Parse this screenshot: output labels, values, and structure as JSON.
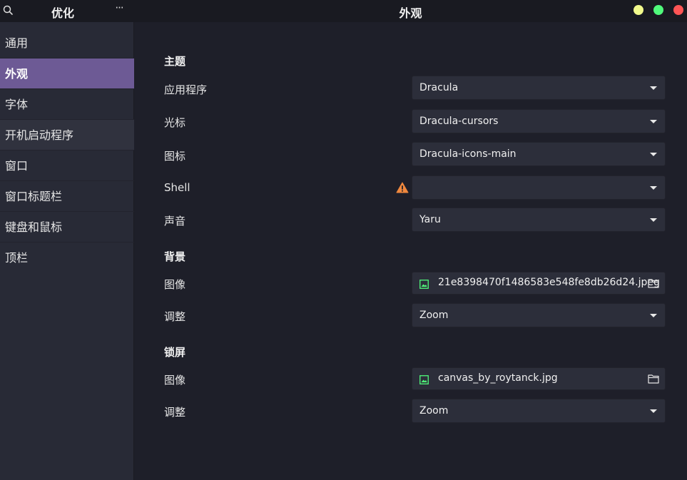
{
  "sidebar": {
    "title": "优化",
    "menu_glyph": "···",
    "items": [
      {
        "label": "通用"
      },
      {
        "label": "外观"
      },
      {
        "label": "字体"
      },
      {
        "label": "开机启动程序"
      },
      {
        "label": "窗口"
      },
      {
        "label": "窗口标题栏"
      },
      {
        "label": "键盘和鼠标"
      },
      {
        "label": "顶栏"
      }
    ],
    "active_item": "外观"
  },
  "main": {
    "title": "外观",
    "theme": {
      "section_title": "主题",
      "application": {
        "label": "应用程序",
        "value": "Dracula"
      },
      "cursor": {
        "label": "光标",
        "value": "Dracula-cursors"
      },
      "icons": {
        "label": "图标",
        "value": "Dracula-icons-main"
      },
      "shell": {
        "label": "Shell",
        "value": ""
      },
      "sound": {
        "label": "声音",
        "value": "Yaru"
      }
    },
    "background": {
      "section_title": "背景",
      "image": {
        "label": "图像",
        "value": "21e8398470f1486583e548fe8db26d24.jpeg"
      },
      "adjust": {
        "label": "调整",
        "value": "Zoom"
      }
    },
    "lockscreen": {
      "section_title": "锁屏",
      "image": {
        "label": "图像",
        "value": "canvas_by_roytanck.jpg"
      },
      "adjust": {
        "label": "调整",
        "value": "Zoom"
      }
    }
  },
  "icons": {
    "search": "search-icon",
    "warning": "warning-icon",
    "image": "image-icon",
    "folder": "folder-icon",
    "dropdown": "chevron-down-icon"
  },
  "colors": {
    "accent": "#6d5a95",
    "minimize": "#f1fa8c",
    "maximize": "#50fa7b",
    "close": "#ff5555",
    "warning": "#f0883e",
    "image_icon": "#50fa7b"
  }
}
